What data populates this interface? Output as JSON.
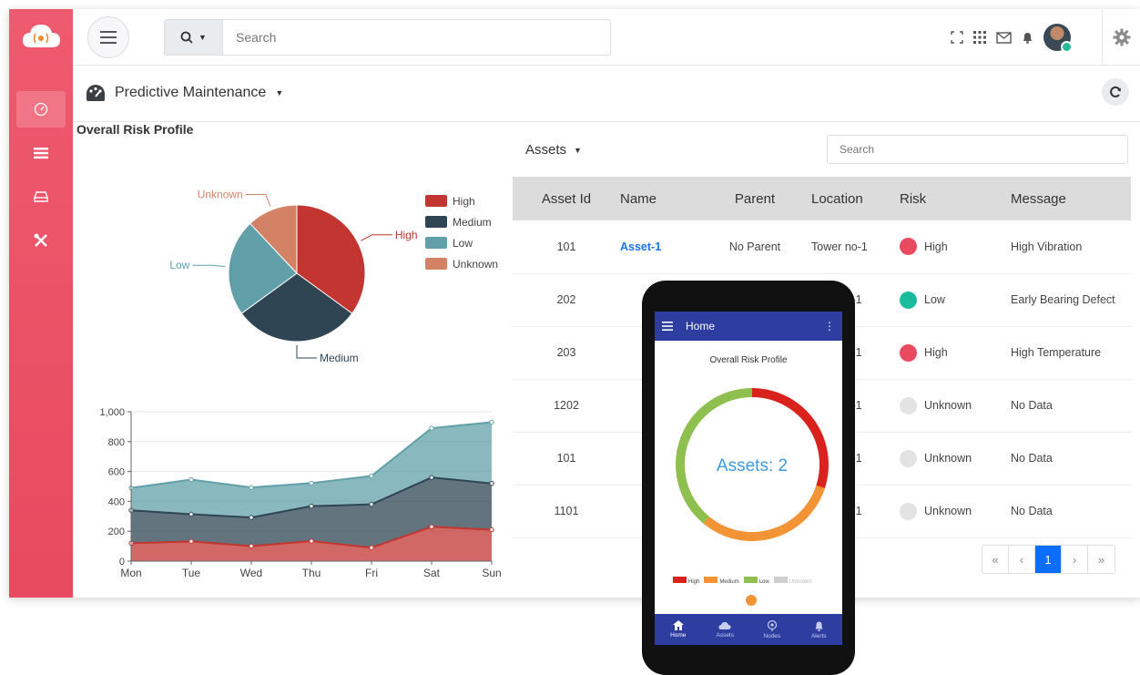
{
  "topbar": {
    "search_placeholder": "Search",
    "icons": [
      "expand-icon",
      "apps-grid-icon",
      "mail-icon",
      "bell-icon",
      "avatar",
      "gear-icon"
    ]
  },
  "sidebar": {
    "items": [
      {
        "icon": "dashboard-gauge-icon",
        "active": true
      },
      {
        "icon": "list-icon",
        "active": false
      },
      {
        "icon": "drive-icon",
        "active": false
      },
      {
        "icon": "tools-icon",
        "active": false
      }
    ]
  },
  "page": {
    "title": "Predictive Maintenance",
    "risk_title": "Overall Risk Profile"
  },
  "colors": {
    "sidebar": "#e84a5f",
    "high": "#c23531",
    "medium": "#2f4554",
    "low": "#61a0a8",
    "unknown": "#d48265",
    "link": "#1a73e8",
    "phone_bar": "#2d3ea0"
  },
  "chart_data": [
    {
      "type": "pie",
      "title": "",
      "slices": [
        {
          "name": "High",
          "value": 35
        },
        {
          "name": "Medium",
          "value": 30
        },
        {
          "name": "Low",
          "value": 23
        },
        {
          "name": "Unknown",
          "value": 12
        }
      ],
      "legend": [
        "High",
        "Medium",
        "Low",
        "Unknown"
      ],
      "legend_position": "right"
    },
    {
      "type": "area",
      "stacked": true,
      "categories": [
        "Mon",
        "Tue",
        "Wed",
        "Thu",
        "Fri",
        "Sat",
        "Sun"
      ],
      "series": [
        {
          "values": [
            120,
            132,
            101,
            134,
            90,
            230,
            210
          ]
        },
        {
          "values": [
            220,
            182,
            191,
            234,
            290,
            330,
            310
          ]
        },
        {
          "values": [
            150,
            232,
            201,
            154,
            190,
            330,
            410
          ]
        }
      ],
      "yticks": [
        "0",
        "200",
        "400",
        "600",
        "800",
        "1,000"
      ],
      "ylim": [
        0,
        1000
      ],
      "grid": true
    },
    {
      "type": "pie",
      "title": "Overall Risk Profile",
      "slices": [
        {
          "name": "High",
          "value": 30
        },
        {
          "name": "Medium",
          "value": 31
        },
        {
          "name": "Low",
          "value": 39
        },
        {
          "name": "Unknown",
          "value": 0
        }
      ],
      "center_label": "Assets: 2"
    }
  ],
  "assets": {
    "title": "Assets",
    "search_placeholder": "Search",
    "columns": [
      "Asset Id",
      "Name",
      "Parent",
      "Location",
      "Risk",
      "Message"
    ],
    "rows": [
      {
        "id": "101",
        "name": "Asset-1",
        "parent": "No Parent",
        "location": "Tower no-1",
        "risk": "High",
        "risk_color": "#e84a5f",
        "message": "High Vibration"
      },
      {
        "id": "202",
        "name": "",
        "parent": "",
        "location": "ower no-1",
        "risk": "Low",
        "risk_color": "#1abc9c",
        "message": "Early Bearing Defect"
      },
      {
        "id": "203",
        "name": "",
        "parent": "",
        "location": "ower no-1",
        "risk": "High",
        "risk_color": "#e84a5f",
        "message": "High Temperature"
      },
      {
        "id": "1202",
        "name": "",
        "parent": "",
        "location": "ower no-1",
        "risk": "Unknown",
        "risk_color": "#e3e3e3",
        "message": "No Data"
      },
      {
        "id": "101",
        "name": "",
        "parent": "",
        "location": "ower no-1",
        "risk": "Unknown",
        "risk_color": "#e3e3e3",
        "message": "No Data"
      },
      {
        "id": "1101",
        "name": "",
        "parent": "",
        "location": "ower no-1",
        "risk": "Unknown",
        "risk_color": "#e3e3e3",
        "message": "No Data"
      }
    ],
    "pagination": {
      "first": "«",
      "prev": "‹",
      "current": "1",
      "next": "›",
      "last": "»"
    }
  },
  "phone": {
    "appbar_title": "Home",
    "chart_title": "Overall Risk Profile",
    "legend": [
      "High",
      "Medium",
      "Low",
      "Unknown"
    ],
    "nav": [
      "Home",
      "Assets",
      "Nodes",
      "Alerts"
    ]
  }
}
